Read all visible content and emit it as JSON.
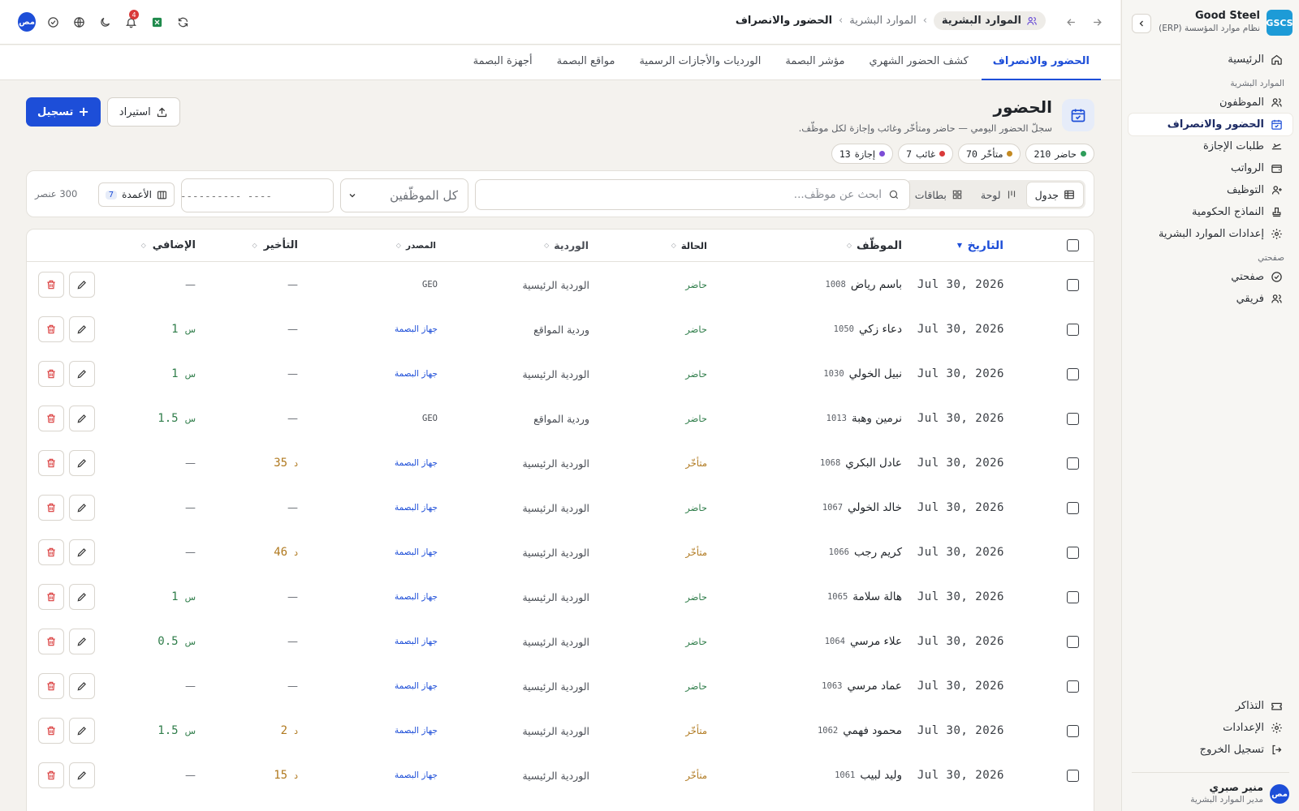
{
  "brand": {
    "logo": "GSCS",
    "name": "Good Steel",
    "subtitle": "نظام موارد المؤسسة (ERP)"
  },
  "sidebar": {
    "home": "الرئيسية",
    "group_hr": "الموارد البشرية",
    "items": [
      {
        "label": "الموظفون",
        "icon": "users-icon"
      },
      {
        "label": "الحضور والانصراف",
        "icon": "calendar-check-icon",
        "active": true
      },
      {
        "label": "طلبات الإجازة",
        "icon": "plane-icon"
      },
      {
        "label": "الرواتب",
        "icon": "wallet-icon"
      },
      {
        "label": "التوظيف",
        "icon": "user-plus-icon"
      },
      {
        "label": "النماذج الحكومية",
        "icon": "stamp-icon"
      },
      {
        "label": "إعدادات الموارد البشرية",
        "icon": "gear-icon"
      }
    ],
    "group_mine": "صفحتي",
    "mine_items": [
      {
        "label": "صفحتي",
        "icon": "check-circle-icon"
      },
      {
        "label": "فريقي",
        "icon": "team-icon"
      }
    ],
    "bottom": {
      "tickets": "التذاكر",
      "settings": "الإعدادات",
      "logout": "تسجيل الخروج"
    },
    "user": {
      "initials": "مص",
      "name": "منير صبري",
      "role": "مدير الموارد البشرية"
    }
  },
  "topbar": {
    "crumb_module": "الموارد البشرية",
    "crumb_parent": "الموارد البشرية",
    "crumb_current": "الحضور والانصراف",
    "notifications": "4",
    "user_initials": "مص"
  },
  "tabs": [
    "الحضور والانصراف",
    "كشف الحضور الشهري",
    "مؤشر البصمة",
    "الورديات والأجازات الرسمية",
    "مواقع البصمة",
    "أجهزة البصمة"
  ],
  "page": {
    "title": "الحضور",
    "subtitle": "سجلّ الحضور اليومي — حاضر ومتأخّر وغائب وإجازة لكل موظّف.",
    "import_label": "استيراد",
    "register_label": "تسجيل",
    "stats": [
      {
        "label": "حاضر",
        "value": "210",
        "color": "#2f9e5b"
      },
      {
        "label": "متأخّر",
        "value": "70",
        "color": "#c48a22"
      },
      {
        "label": "غائب",
        "value": "7",
        "color": "#d93a3a"
      },
      {
        "label": "إجازة",
        "value": "13",
        "color": "#7c4dd6"
      }
    ]
  },
  "toolbar": {
    "view_table": "جدول",
    "view_board": "لوحة",
    "view_cards": "بطاقات",
    "search_placeholder": "ابحث عن موظّف...",
    "employee_filter": "كل الموظّفين",
    "date_placeholder": "---------- ----",
    "columns_label": "الأعمدة",
    "columns_count": "7",
    "row_count": "300 عنصر"
  },
  "table": {
    "headers": {
      "date": "التاريخ",
      "employee": "الموظّف",
      "status": "الحالة",
      "shift": "الوردية",
      "source": "المصدر",
      "late": "التأخير",
      "overtime": "الإضافي"
    },
    "units": {
      "late": "د",
      "overtime": "س"
    },
    "rows": [
      {
        "date": "Jul 30, 2026",
        "name": "باسم رياض",
        "id": "1008",
        "status": "حاضر",
        "status_type": "present",
        "shift": "الوردية الرئيسية",
        "source": "GEO",
        "source_type": "geo",
        "late": "—",
        "overtime": "—"
      },
      {
        "date": "Jul 30, 2026",
        "name": "دعاء زكي",
        "id": "1050",
        "status": "حاضر",
        "status_type": "present",
        "shift": "وردية المواقع",
        "source": "جهاز البصمة",
        "source_type": "device",
        "late": "—",
        "overtime": "1"
      },
      {
        "date": "Jul 30, 2026",
        "name": "نبيل الخولي",
        "id": "1030",
        "status": "حاضر",
        "status_type": "present",
        "shift": "الوردية الرئيسية",
        "source": "جهاز البصمة",
        "source_type": "device",
        "late": "—",
        "overtime": "1"
      },
      {
        "date": "Jul 30, 2026",
        "name": "نرمين وهبة",
        "id": "1013",
        "status": "حاضر",
        "status_type": "present",
        "shift": "وردية المواقع",
        "source": "GEO",
        "source_type": "geo",
        "late": "—",
        "overtime": "1.5"
      },
      {
        "date": "Jul 30, 2026",
        "name": "عادل البكري",
        "id": "1068",
        "status": "متأخّر",
        "status_type": "late",
        "shift": "الوردية الرئيسية",
        "source": "جهاز البصمة",
        "source_type": "device",
        "late": "35",
        "overtime": "—"
      },
      {
        "date": "Jul 30, 2026",
        "name": "خالد الخولي",
        "id": "1067",
        "status": "حاضر",
        "status_type": "present",
        "shift": "الوردية الرئيسية",
        "source": "جهاز البصمة",
        "source_type": "device",
        "late": "—",
        "overtime": "—"
      },
      {
        "date": "Jul 30, 2026",
        "name": "كريم رجب",
        "id": "1066",
        "status": "متأخّر",
        "status_type": "late",
        "shift": "الوردية الرئيسية",
        "source": "جهاز البصمة",
        "source_type": "device",
        "late": "46",
        "overtime": "—"
      },
      {
        "date": "Jul 30, 2026",
        "name": "هالة سلامة",
        "id": "1065",
        "status": "حاضر",
        "status_type": "present",
        "shift": "الوردية الرئيسية",
        "source": "جهاز البصمة",
        "source_type": "device",
        "late": "—",
        "overtime": "1"
      },
      {
        "date": "Jul 30, 2026",
        "name": "علاء مرسي",
        "id": "1064",
        "status": "حاضر",
        "status_type": "present",
        "shift": "الوردية الرئيسية",
        "source": "جهاز البصمة",
        "source_type": "device",
        "late": "—",
        "overtime": "0.5"
      },
      {
        "date": "Jul 30, 2026",
        "name": "عماد مرسي",
        "id": "1063",
        "status": "حاضر",
        "status_type": "present",
        "shift": "الوردية الرئيسية",
        "source": "جهاز البصمة",
        "source_type": "device",
        "late": "—",
        "overtime": "—"
      },
      {
        "date": "Jul 30, 2026",
        "name": "محمود فهمي",
        "id": "1062",
        "status": "متأخّر",
        "status_type": "late",
        "shift": "الوردية الرئيسية",
        "source": "جهاز البصمة",
        "source_type": "device",
        "late": "2",
        "overtime": "1.5"
      },
      {
        "date": "Jul 30, 2026",
        "name": "وليد لبيب",
        "id": "1061",
        "status": "متأخّر",
        "status_type": "late",
        "shift": "الوردية الرئيسية",
        "source": "جهاز البصمة",
        "source_type": "device",
        "late": "15",
        "overtime": "—"
      }
    ]
  }
}
